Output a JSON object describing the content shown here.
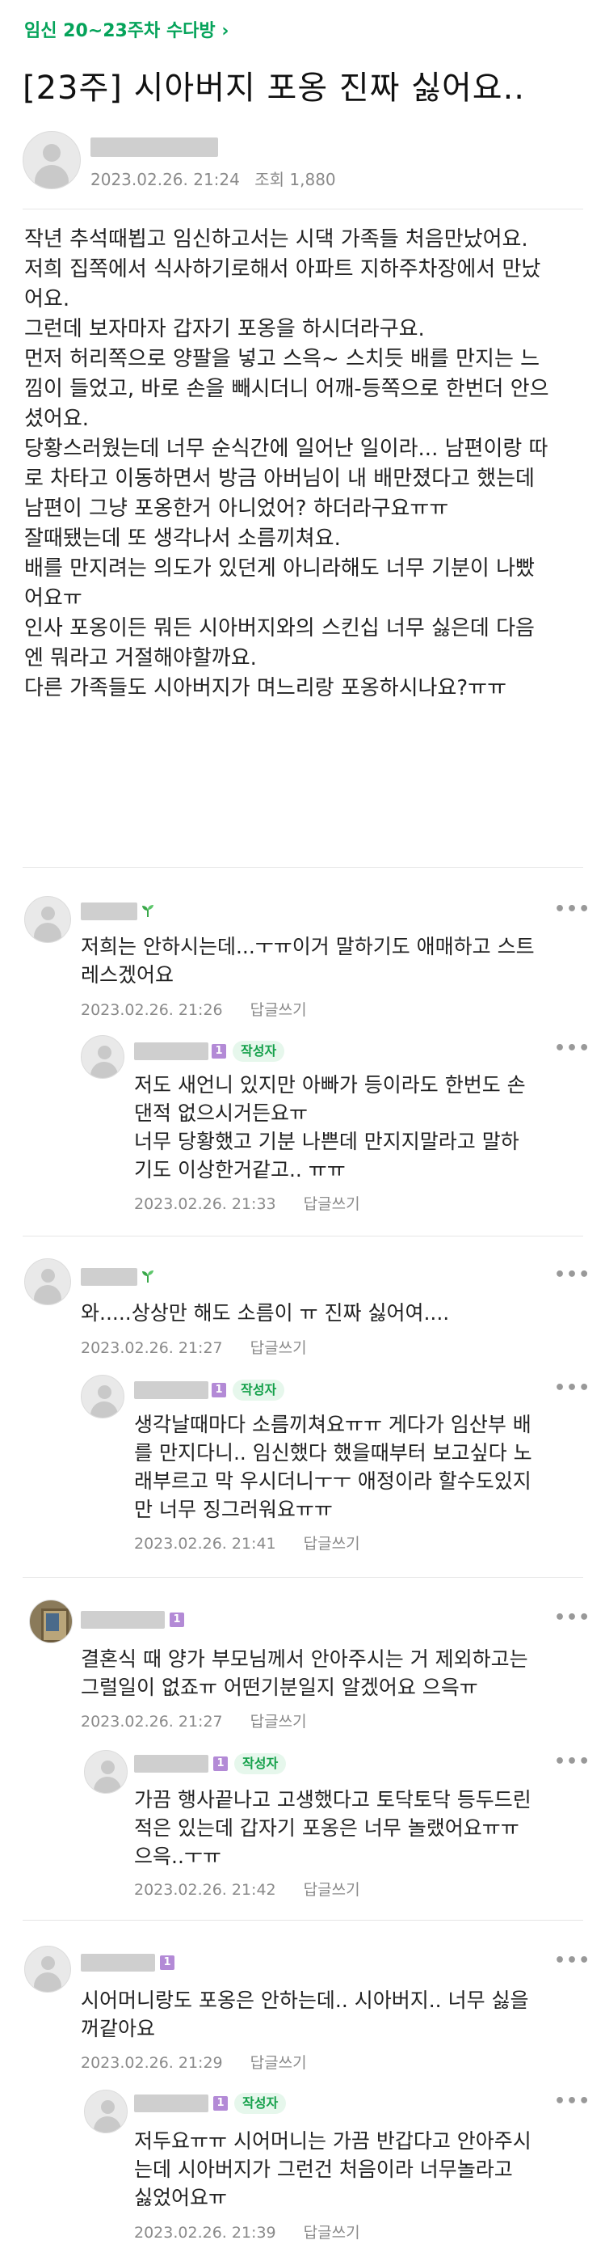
{
  "breadcrumb": {
    "label": "임신 20~23주차 수다방",
    "chevron": "›"
  },
  "post": {
    "title": "[23주] 시아버지 포옹 진짜 싫어요..",
    "date": "2023.02.26. 21:24",
    "views": "조회 1,880",
    "body": [
      "작년 추석때뵙고 임신하고서는 시댁 가족들 처음만났어요.",
      "저희 집쪽에서 식사하기로해서 아파트 지하주차장에서 만났\n어요.",
      "그런데 보자마자 갑자기 포옹을 하시더라구요.",
      "먼저 허리쪽으로 양팔을 넣고 스윽~ 스치듯 배를 만지는 느\n낌이 들었고, 바로 손을 빼시더니 어깨-등쪽으로 한번더 안으\n셨어요.",
      "당황스러웠는데 너무 순식간에 일어난 일이라... 남편이랑 따\n로 차타고 이동하면서 방금 아버님이 내 배만졌다고 했는데\n남편이 그냥 포옹한거 아니었어? 하더라구요ㅠㅠ",
      "잘때됐는데 또 생각나서 소름끼쳐요.",
      "배를 만지려는 의도가 있던게 아니라해도 너무 기분이 나빴\n어요ㅠ",
      "인사 포옹이든 뭐든 시아버지와의 스킨십 너무 싫은데 다음\n엔 뭐라고 거절해야할까요.",
      "다른 가족들도 시아버지가 며느리랑 포옹하시나요?ㅠㅠ"
    ]
  },
  "labels": {
    "reply": "답글쓰기",
    "writer_badge": "작성자",
    "more": "•••",
    "level": "1"
  },
  "comments": [
    {
      "text": "저희는 안하시는데...ㅜㅠ이거 말하기도 애매하고 스트\n레스겠어요",
      "date": "2023.02.26. 21:26",
      "reply": {
        "text": "저도 새언니 있지만 아빠가 등이라도 한번도 손\n댄적 없으시거든요ㅠ\n너무 당황했고 기분 나쁜데 만지지말라고 말하\n기도 이상한거같고.. ㅠㅠ",
        "date": "2023.02.26. 21:33"
      }
    },
    {
      "text": "와.....상상만 해도 소름이 ㅠ 진짜 싫어여....",
      "date": "2023.02.26. 21:27",
      "reply": {
        "text": "생각날때마다 소름끼쳐요ㅠㅠ 게다가 임산부 배\n를 만지다니.. 임신했다 했을때부터 보고싶다 노\n래부르고 막 우시더니ㅜㅜ 애정이라 할수도있지\n만 너무 징그러워요ㅠㅠ",
        "date": "2023.02.26. 21:41"
      }
    },
    {
      "text": "결혼식 때 양가 부모님께서 안아주시는 거 제외하고는\n그럴일이 없죠ㅠ 어떤기분일지 알겠어요 으윽ㅠ",
      "date": "2023.02.26. 21:27",
      "reply": {
        "text": "가끔 행사끝나고 고생했다고 토닥토닥 등두드린\n적은 있는데 갑자기 포옹은 너무 놀랬어요ㅠㅠ\n으윽..ㅜㅠ",
        "date": "2023.02.26. 21:42"
      }
    },
    {
      "text": "시어머니랑도 포옹은 안하는데.. 시아버지.. 너무 싫을\n꺼같아요",
      "date": "2023.02.26. 21:29",
      "reply": {
        "text": "저두요ㅠㅠ 시어머니는 가끔 반갑다고 안아주시\n는데 시아버지가 그런건 처음이라 너무놀라고\n싫었어요ㅠ",
        "date": "2023.02.26. 21:39"
      }
    }
  ],
  "colors": {
    "accent": "#05a35a",
    "writer_badge_bg": "#e6f7ec",
    "level_badge": "#b38ad6"
  }
}
